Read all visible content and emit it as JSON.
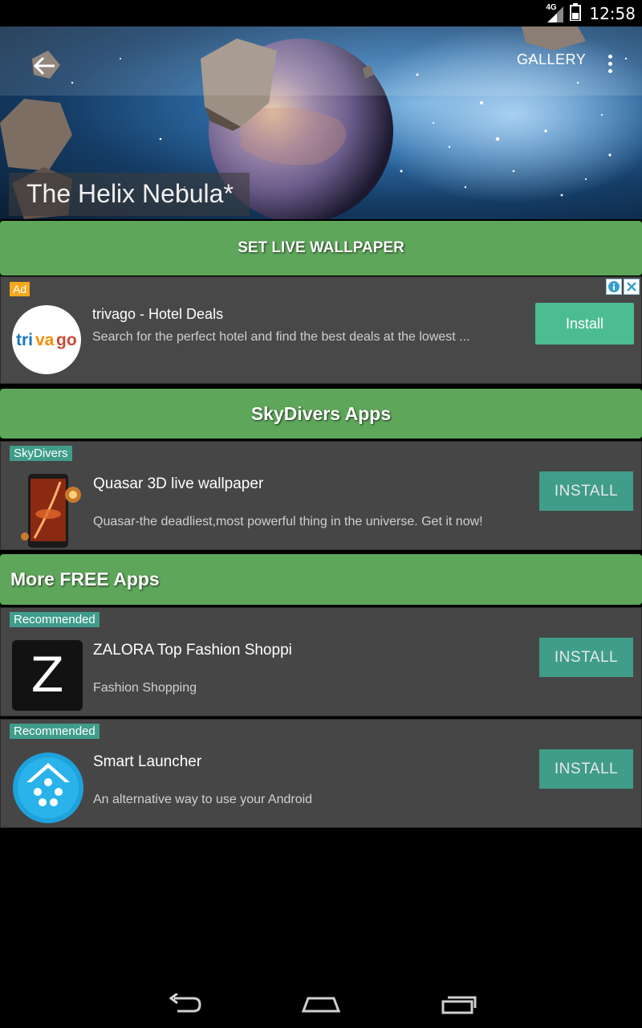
{
  "status_bar": {
    "network": "4G",
    "time": "12:58",
    "icons": [
      "signal-icon",
      "battery-icon"
    ]
  },
  "toolbar": {
    "back_icon": "back-arrow-icon",
    "gallery_label": "GALLERY",
    "menu_icon": "overflow-menu-icon"
  },
  "hero": {
    "title": "The Helix Nebula*"
  },
  "set_wallpaper": {
    "label": "SET LIVE WALLPAPER"
  },
  "ad": {
    "badge": "Ad",
    "logo_text": "trivago",
    "title": "trivago - Hotel Deals",
    "description": "Search for the perfect hotel and find the best deals at the lowest ...",
    "install_label": "Install",
    "info_icons": [
      "info-icon",
      "close-icon"
    ]
  },
  "sections": {
    "skydivers_header": "SkyDivers Apps",
    "more_header": "More FREE Apps"
  },
  "apps": [
    {
      "tag": "SkyDivers",
      "title": "Quasar 3D live wallpaper",
      "description": "Quasar-the deadliest,most powerful thing in the universe. Get it now!",
      "install_label": "INSTALL",
      "icon": "quasar-app-icon"
    },
    {
      "tag": "Recommended",
      "title": "ZALORA Top Fashion Shoppi",
      "description": "Fashion Shopping",
      "install_label": "INSTALL",
      "icon": "zalora-app-icon",
      "icon_letter": "Z"
    },
    {
      "tag": "Recommended",
      "title": "Smart Launcher",
      "description": "An alternative way to use your Android",
      "install_label": "INSTALL",
      "icon": "smart-launcher-app-icon"
    }
  ],
  "nav_bar": {
    "buttons": [
      "back-nav-icon",
      "home-nav-icon",
      "recents-nav-icon"
    ]
  },
  "colors": {
    "accent_green": "#5ea65a",
    "install_teal": "#3f9d8a",
    "ad_install": "#4cbc92",
    "ad_badge": "#f4a91c",
    "card_bg": "#464646"
  }
}
